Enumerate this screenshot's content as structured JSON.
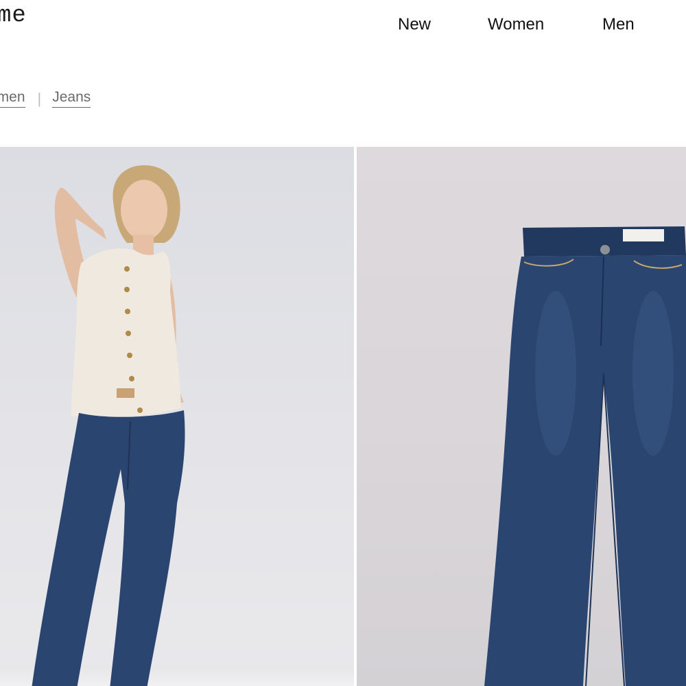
{
  "header": {
    "logo_text": "me",
    "nav": [
      "New",
      "Women",
      "Men"
    ]
  },
  "breadcrumb": [
    "omen",
    "Jeans"
  ],
  "gallery": {
    "images": [
      {
        "alt": "Model wearing cream knit vest and dark wash flare jeans"
      },
      {
        "alt": "Dark wash flare jeans flat product shot"
      }
    ]
  },
  "colors": {
    "denim": "#2a4570",
    "denim_dark": "#1e3356",
    "vest": "#efe9df",
    "skin": "#e6c0a6",
    "hair": "#c9a877",
    "background_left": "#e2e3e7",
    "background_right": "#d9d5d9"
  }
}
